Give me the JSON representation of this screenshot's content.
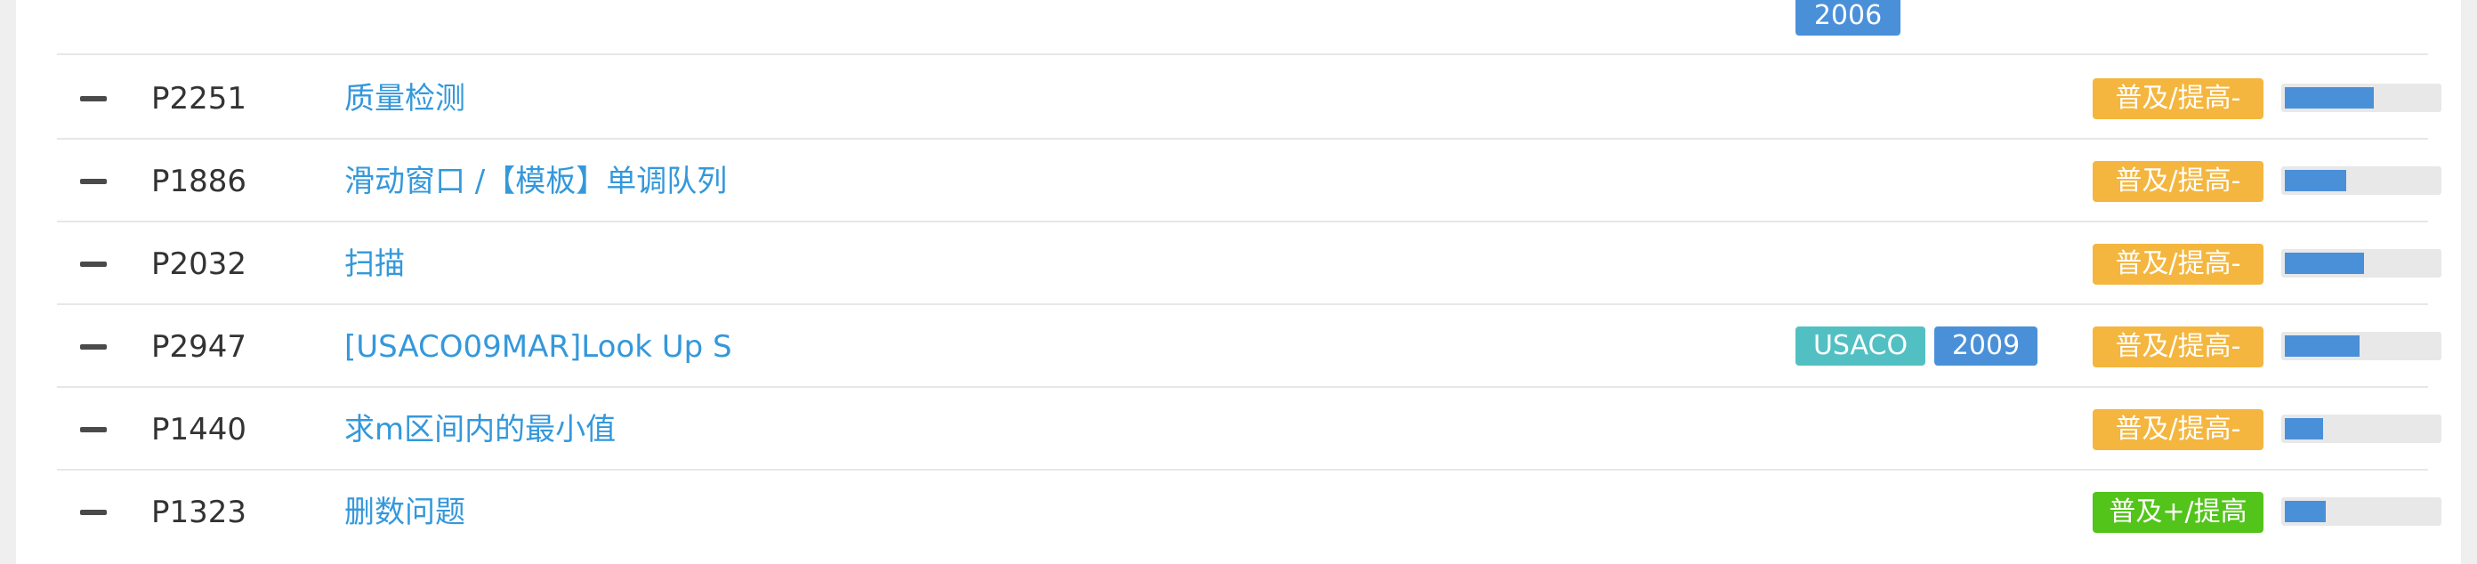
{
  "top_row": {
    "year_tag": "2006"
  },
  "problems": [
    {
      "id": "P2251",
      "title": "质量检测",
      "tags": [],
      "difficulty": "普及/提高-",
      "difficulty_color": "#f4b63e",
      "pass_rate": 0.58
    },
    {
      "id": "P1886",
      "title": "滑动窗口 /【模板】单调队列",
      "tags": [],
      "difficulty": "普及/提高-",
      "difficulty_color": "#f4b63e",
      "pass_rate": 0.4
    },
    {
      "id": "P2032",
      "title": "扫描",
      "tags": [],
      "difficulty": "普及/提高-",
      "difficulty_color": "#f4b63e",
      "pass_rate": 0.52
    },
    {
      "id": "P2947",
      "title": "[USACO09MAR]Look Up S",
      "tags": [
        {
          "label": "USACO",
          "kind": "source"
        },
        {
          "label": "2009",
          "kind": "year"
        }
      ],
      "difficulty": "普及/提高-",
      "difficulty_color": "#f4b63e",
      "pass_rate": 0.49
    },
    {
      "id": "P1440",
      "title": "求m区间内的最小值",
      "tags": [],
      "difficulty": "普及/提高-",
      "difficulty_color": "#f4b63e",
      "pass_rate": 0.25
    },
    {
      "id": "P1323",
      "title": "删数问题",
      "tags": [],
      "difficulty": "普及+/提高",
      "difficulty_color": "#52c41a",
      "pass_rate": 0.27
    }
  ]
}
